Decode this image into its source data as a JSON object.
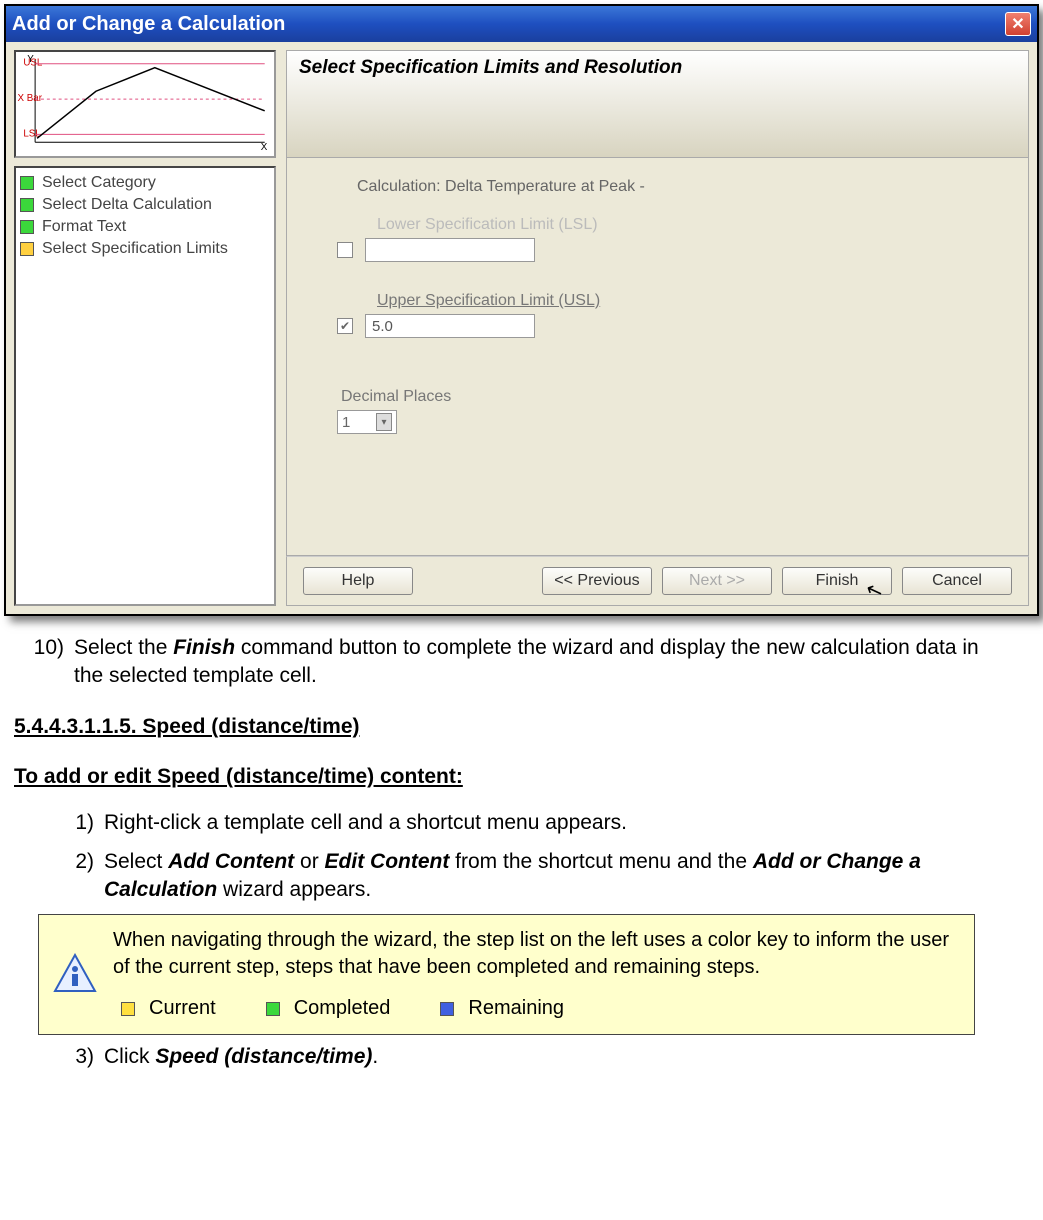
{
  "dialog": {
    "title": "Add or Change a Calculation",
    "panel_title": "Select Specification Limits and Resolution",
    "calc_label": "Calculation: Delta Temperature at Peak -",
    "lsl_label": "Lower Specification Limit (LSL)",
    "lsl_value": "",
    "usl_label": "Upper Specification Limit (USL)",
    "usl_value": "5.0",
    "decimal_label": "Decimal Places",
    "decimal_value": "1",
    "steps": [
      {
        "label": "Select Category",
        "color": "green"
      },
      {
        "label": "Select Delta Calculation",
        "color": "green"
      },
      {
        "label": "Format Text",
        "color": "green"
      },
      {
        "label": "Select Specification Limits",
        "color": "yellow"
      }
    ],
    "buttons": {
      "help": "Help",
      "previous": "<< Previous",
      "next": "Next >>",
      "finish": "Finish",
      "cancel": "Cancel"
    }
  },
  "doc": {
    "step10_num": "10)",
    "step10_a": "Select the ",
    "step10_b": "Finish",
    "step10_c": " command button to complete the wizard and display the new calculation data in the selected template cell.",
    "heading1": "5.4.4.3.1.1.5. Speed (distance/time)",
    "heading2": "To add or edit Speed (distance/time) content:",
    "step1_num": "1)",
    "step1": "Right-click a template cell and a shortcut menu appears.",
    "step2_num": "2)",
    "step2_a": "Select ",
    "step2_b": "Add Content",
    "step2_c": " or ",
    "step2_d": "Edit Content",
    "step2_e": " from the shortcut menu and the ",
    "step2_f": "Add or Change a Calculation",
    "step2_g": " wizard appears.",
    "note_text": "When navigating through the wizard, the step list on the left uses a color key to inform the user of the current step, steps that have been completed and remaining steps.",
    "legend": {
      "current": "Current",
      "completed": "Completed",
      "remaining": "Remaining"
    },
    "step3_num": "3)",
    "step3_a": "Click ",
    "step3_b": "Speed (distance/time)",
    "step3_c": "."
  }
}
